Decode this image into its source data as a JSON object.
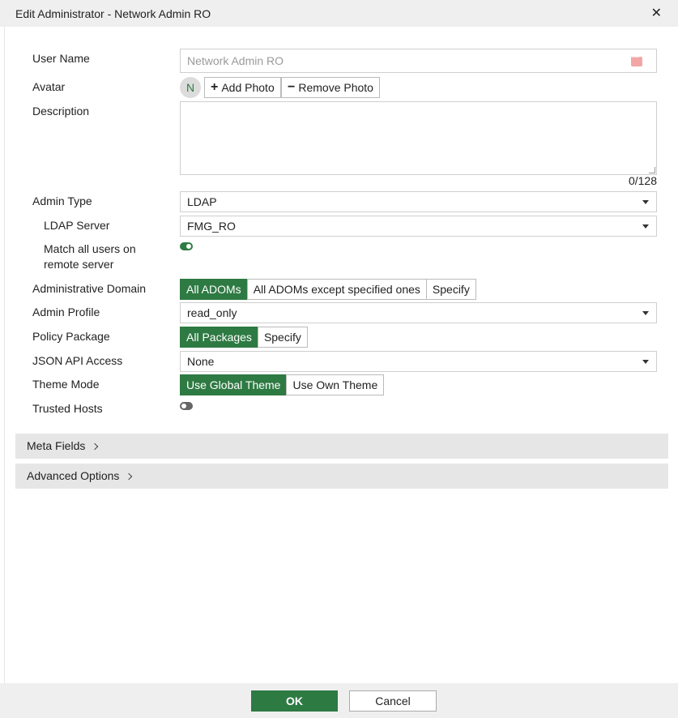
{
  "window": {
    "title": "Edit Administrator - Network Admin RO"
  },
  "form": {
    "user_name": {
      "label": "User Name",
      "placeholder": "Network Admin RO",
      "value": ""
    },
    "avatar": {
      "label": "Avatar",
      "initial": "N",
      "add_label": "Add Photo",
      "remove_label": "Remove Photo"
    },
    "description": {
      "label": "Description",
      "value": "",
      "counter": "0/128"
    },
    "admin_type": {
      "label": "Admin Type",
      "value": "LDAP"
    },
    "ldap_server": {
      "label": "LDAP Server",
      "value": "FMG_RO"
    },
    "match_users": {
      "label_line1": "Match all users on",
      "label_line2": "remote server",
      "enabled": true
    },
    "admin_domain": {
      "label": "Administrative Domain",
      "options": [
        "All ADOMs",
        "All ADOMs except specified ones",
        "Specify"
      ],
      "selected": "All ADOMs"
    },
    "admin_profile": {
      "label": "Admin Profile",
      "value": "read_only"
    },
    "policy_package": {
      "label": "Policy Package",
      "options": [
        "All Packages",
        "Specify"
      ],
      "selected": "All Packages"
    },
    "json_api": {
      "label": "JSON API Access",
      "value": "None"
    },
    "theme_mode": {
      "label": "Theme Mode",
      "options": [
        "Use Global Theme",
        "Use Own Theme"
      ],
      "selected": "Use Global Theme"
    },
    "trusted_hosts": {
      "label": "Trusted Hosts",
      "enabled": false
    }
  },
  "sections": {
    "meta_fields": "Meta Fields",
    "advanced_options": "Advanced Options"
  },
  "footer": {
    "ok_label": "OK",
    "cancel_label": "Cancel"
  },
  "colors": {
    "accent": "#2e7a43",
    "header_bg": "#efefef",
    "section_bg": "#e6e6e6"
  },
  "icons": {
    "close": "close-icon",
    "add": "plus-icon",
    "remove": "minus-icon",
    "dropdown": "caret-down-icon",
    "expand": "chevron-right-icon",
    "password": "password-dots-icon"
  }
}
